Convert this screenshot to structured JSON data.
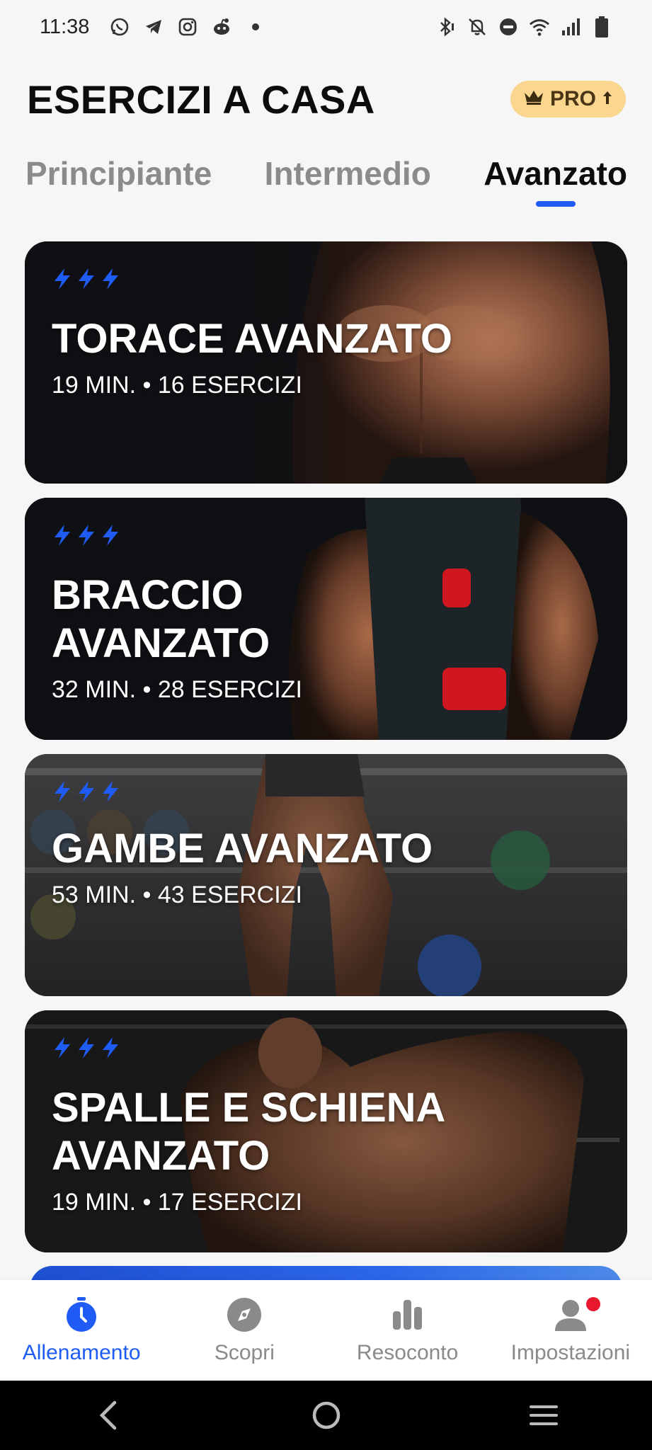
{
  "status_bar": {
    "time": "11:38",
    "icons_left": [
      "whatsapp-icon",
      "telegram-icon",
      "instagram-icon",
      "reddit-icon",
      "dot-icon"
    ],
    "icons_right": [
      "bluetooth-icon",
      "mute-icon",
      "dnd-icon",
      "wifi-icon",
      "signal-icon",
      "battery-icon"
    ]
  },
  "header": {
    "title": "ESERCIZI A CASA",
    "pro_label": "PRO"
  },
  "tabs": [
    {
      "label": "Principiante",
      "active": false
    },
    {
      "label": "Intermedio",
      "active": false
    },
    {
      "label": "Avanzato",
      "active": true
    }
  ],
  "workouts": [
    {
      "title": "TORACE AVANZATO",
      "meta": "19 MIN. • 16 ESERCIZI",
      "level_icons": 3
    },
    {
      "title": "BRACCIO AVANZATO",
      "meta": "32 MIN. • 28 ESERCIZI",
      "level_icons": 3
    },
    {
      "title": "GAMBE AVANZATO",
      "meta": "53 MIN. • 43 ESERCIZI",
      "level_icons": 3
    },
    {
      "title": "SPALLE E SCHIENA AVANZATO",
      "meta": "19 MIN. • 17 ESERCIZI",
      "level_icons": 3
    }
  ],
  "bottom_nav": [
    {
      "label": "Allenamento",
      "icon": "stopwatch-icon",
      "active": true
    },
    {
      "label": "Scopri",
      "icon": "compass-icon",
      "active": false
    },
    {
      "label": "Resoconto",
      "icon": "bar-chart-icon",
      "active": false
    },
    {
      "label": "Impostazioni",
      "icon": "profile-icon",
      "active": false,
      "badge": true
    }
  ],
  "colors": {
    "accent": "#1f5cf5",
    "pro_badge": "#fbd68e",
    "notification": "#e8192c"
  }
}
